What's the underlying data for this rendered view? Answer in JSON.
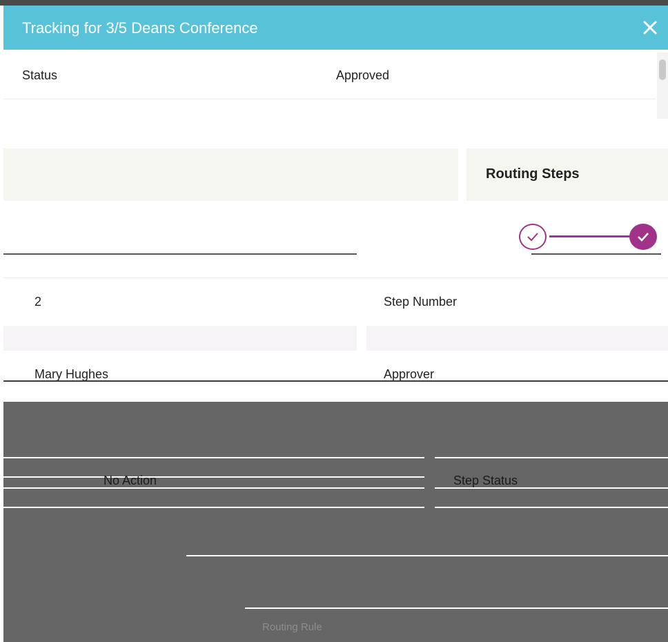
{
  "dialog": {
    "title": "Tracking for 3/5 Deans Conference",
    "close_icon": "close-icon"
  },
  "summary": {
    "status_label": "Status",
    "status_value": "Approved"
  },
  "routing": {
    "title": "Routing Steps",
    "steps": [
      {
        "icon": "check-circle-outline-icon",
        "state": "current"
      },
      {
        "icon": "check-circle-filled-icon",
        "state": "completed"
      }
    ],
    "accent_color": "#a03389"
  },
  "step_detail": {
    "step_number_value": "2",
    "step_number_label": "Step Number",
    "approver_value": "Mary Hughes",
    "approver_label": "Approver",
    "step_status_value": "No Action",
    "step_status_label": "Step Status",
    "routing_rule_label": "Routing Rule"
  },
  "colors": {
    "header_bg": "#58c3d8",
    "header_text": "#ffffff"
  }
}
